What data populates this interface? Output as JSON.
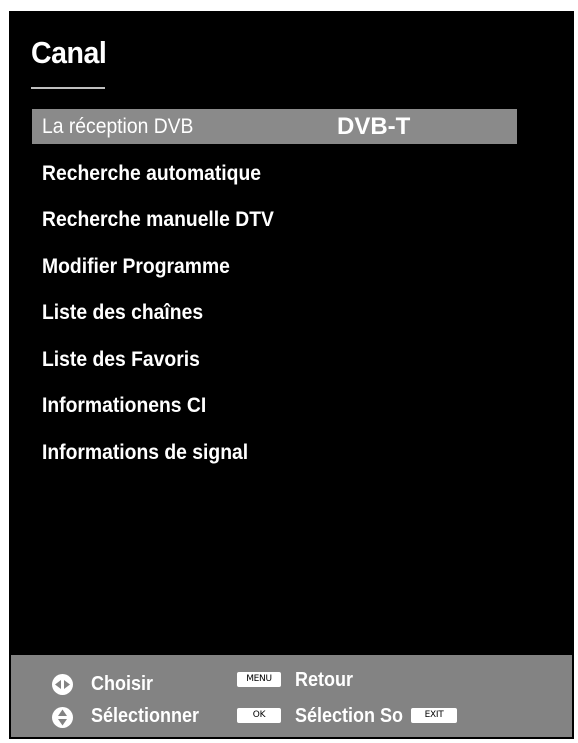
{
  "menu": {
    "title": "Canal",
    "items": [
      {
        "label": "La réception DVB",
        "value": "DVB-T",
        "selected": true
      },
      {
        "label": "Recherche automatique"
      },
      {
        "label": "Recherche manuelle DTV"
      },
      {
        "label": "Modifier Programme"
      },
      {
        "label": "Liste des chaînes"
      },
      {
        "label": "Liste des Favoris"
      },
      {
        "label": "Informationens CI"
      },
      {
        "label": "Informations de signal"
      }
    ]
  },
  "footer": {
    "choose_label": "Choisir",
    "select_label": "Sélectionner",
    "menu_key": "MENU",
    "back_label": "Retour",
    "ok_key": "OK",
    "selection_label": "Sélection So",
    "exit_key": "EXIT"
  },
  "colors": {
    "background": "#000000",
    "highlight": "#8a8a8a",
    "footer": "#838383",
    "text": "#ffffff"
  },
  "icons": {
    "left_right": "left-right-arrows-icon",
    "up_down": "up-down-arrows-icon"
  }
}
